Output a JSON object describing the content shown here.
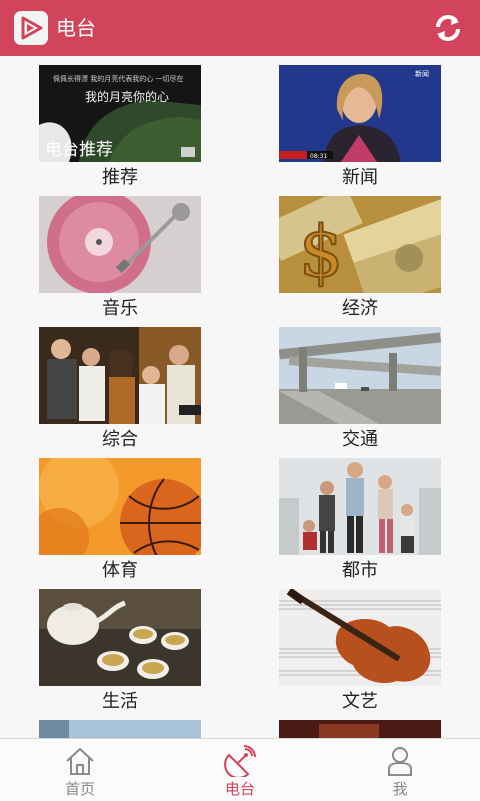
{
  "app": {
    "title": "电台",
    "logo_icon": "play-logo-icon",
    "refresh_icon": "refresh-icon",
    "accent": "#d2445b"
  },
  "featured_overlay": {
    "lyric_small": "佩佩长得漂 我的月亮代表我的心 一切尽在",
    "lyric_big": "我的月亮你的心",
    "badge": "电台推荐"
  },
  "news_overlay": {
    "channel": "新闻",
    "clock": "08:31"
  },
  "categories": [
    {
      "label": "推荐"
    },
    {
      "label": "新闻"
    },
    {
      "label": "音乐"
    },
    {
      "label": "经济"
    },
    {
      "label": "综合"
    },
    {
      "label": "交通"
    },
    {
      "label": "体育"
    },
    {
      "label": "都市"
    },
    {
      "label": "生活"
    },
    {
      "label": "文艺"
    }
  ],
  "tabbar": {
    "tabs": [
      {
        "label": "首页",
        "icon": "home-icon"
      },
      {
        "label": "电台",
        "icon": "radio-dish-icon"
      },
      {
        "label": "我",
        "icon": "user-icon"
      }
    ],
    "active": "电台"
  }
}
